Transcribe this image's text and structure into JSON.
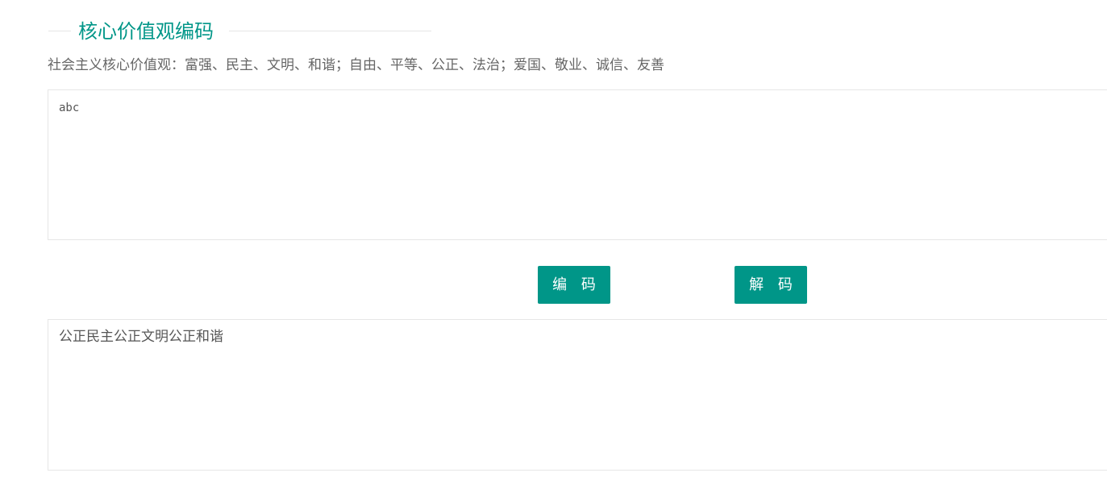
{
  "header": {
    "title": "核心价值观编码",
    "subtitle": "社会主义核心价值观：富强、民主、文明、和谐；自由、平等、公正、法治；爱国、敬业、诚信、友善"
  },
  "input": {
    "value": "abc"
  },
  "buttons": {
    "encode_label": "编 码",
    "decode_label": "解 码"
  },
  "output": {
    "value": "公正民主公正文明公正和谐"
  },
  "colors": {
    "accent": "#009688",
    "text": "#666666",
    "border": "#e6e6e6"
  }
}
